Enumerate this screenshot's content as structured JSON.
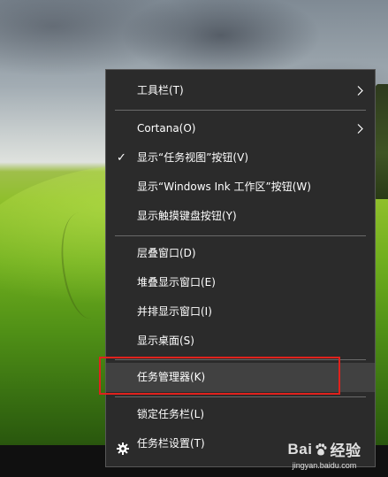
{
  "menu": {
    "items": [
      {
        "label": "工具栏(T)",
        "has_submenu": true,
        "checked": false
      },
      {
        "label": "Cortana(O)",
        "has_submenu": true,
        "checked": false
      },
      {
        "label": "显示“任务视图”按钮(V)",
        "has_submenu": false,
        "checked": true
      },
      {
        "label": "显示“Windows Ink 工作区”按钮(W)",
        "has_submenu": false,
        "checked": false
      },
      {
        "label": "显示触摸键盘按钮(Y)",
        "has_submenu": false,
        "checked": false
      },
      {
        "label": "层叠窗口(D)",
        "has_submenu": false,
        "checked": false
      },
      {
        "label": "堆叠显示窗口(E)",
        "has_submenu": false,
        "checked": false
      },
      {
        "label": "并排显示窗口(I)",
        "has_submenu": false,
        "checked": false
      },
      {
        "label": "显示桌面(S)",
        "has_submenu": false,
        "checked": false
      },
      {
        "label": "任务管理器(K)",
        "has_submenu": false,
        "checked": false,
        "hovered": true
      },
      {
        "label": "锁定任务栏(L)",
        "has_submenu": false,
        "checked": false
      },
      {
        "label": "任务栏设置(T)",
        "has_submenu": false,
        "checked": false,
        "icon": "gear-icon"
      }
    ],
    "check_glyph": "✓"
  },
  "watermark": {
    "logo_text": "Bai",
    "logo_suffix": "经验",
    "url": "jingyan.baidu.com"
  },
  "colors": {
    "menu_bg": "#2b2b2b",
    "menu_hover": "#414141",
    "highlight_border": "#e0221d",
    "text": "#ffffff"
  }
}
